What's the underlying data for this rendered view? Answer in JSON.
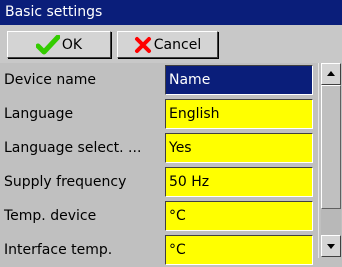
{
  "window": {
    "title": "Basic settings"
  },
  "toolbar": {
    "ok_label": "OK",
    "cancel_label": "Cancel"
  },
  "settings": [
    {
      "label": "Device name",
      "value": "Name",
      "selected": true
    },
    {
      "label": "Language",
      "value": "English",
      "selected": false
    },
    {
      "label": "Language select. ...",
      "value": "Yes",
      "selected": false
    },
    {
      "label": "Supply frequency",
      "value": "50 Hz",
      "selected": false
    },
    {
      "label": "Temp. device",
      "value": "°C",
      "selected": false
    },
    {
      "label": "Interface temp.",
      "value": "°C",
      "selected": false
    }
  ],
  "colors": {
    "title_bg": "#0a1e7a",
    "field_bg": "#ffff00",
    "selected_field_bg": "#0a1e7a",
    "ok_icon": "#33cc00",
    "cancel_icon": "#ff0000"
  },
  "icons": {
    "ok": "checkmark-icon",
    "cancel": "x-mark-icon"
  }
}
